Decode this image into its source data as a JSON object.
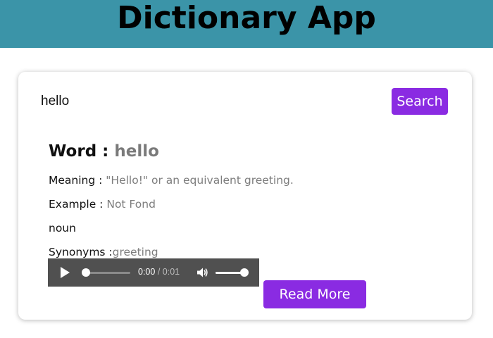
{
  "app": {
    "title": "Dictionary App",
    "header_color": "#3b94a8",
    "accent_color": "#8a2be2"
  },
  "search": {
    "value": "hello",
    "button_label": "Search"
  },
  "result": {
    "word_label": "Word :",
    "word": "hello",
    "meaning_label": "Meaning :",
    "meaning": "\"Hello!\" or an equivalent greeting.",
    "example_label": "Example :",
    "example": "Not Fond",
    "part_of_speech": "noun",
    "synonyms_label": "Synonyms :",
    "synonyms": "greeting"
  },
  "audio": {
    "current_time": "0:00",
    "separator": " / ",
    "duration": "0:01",
    "progress": 0.0,
    "volume": 0.95,
    "play_icon": "play-icon",
    "volume_icon": "volume-icon"
  },
  "read_more_label": "Read More"
}
